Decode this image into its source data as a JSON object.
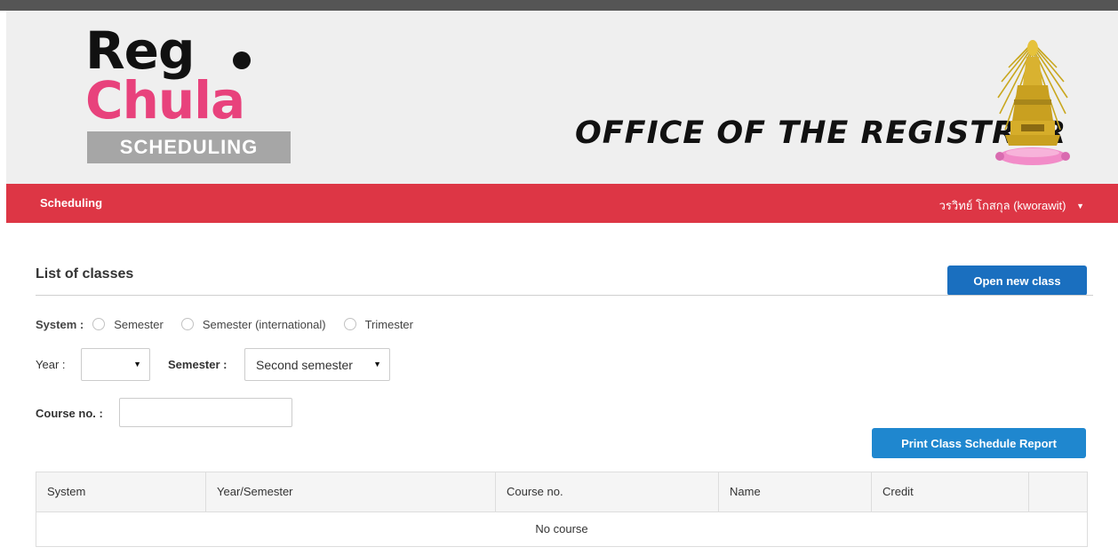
{
  "header": {
    "logo_line1": "Reg",
    "logo_line2": "Chula",
    "logo_badge": "SCHEDULING",
    "office_title": "OFFICE OF THE REGISTRAR",
    "emblem": "chula-emblem-icon"
  },
  "navbar": {
    "left_link": "Scheduling",
    "user_label": "วรวิทย์ โกสกุล (kworawit)",
    "user_caret": "▼",
    "color": "#dd3645"
  },
  "page": {
    "title": "List of classes",
    "open_button": "Open new class",
    "print_button": "Print Class Schedule Report"
  },
  "filters": {
    "system_label": "System :",
    "system_options": [
      "Semester",
      "Semester (international)",
      "Trimester"
    ],
    "year_label": "Year :",
    "year_value": "",
    "semester_label": "Semester :",
    "semester_value": "Second semester",
    "course_label": "Course no. :",
    "course_value": "",
    "select_arrow": "▼"
  },
  "table": {
    "columns": [
      "System",
      "Year/Semester",
      "Course no.",
      "Name",
      "Credit",
      ""
    ],
    "empty_message": "No course"
  },
  "colors": {
    "primary": "#1a6fbf",
    "print": "#1f87cf",
    "logo_pink": "#e8427c"
  }
}
